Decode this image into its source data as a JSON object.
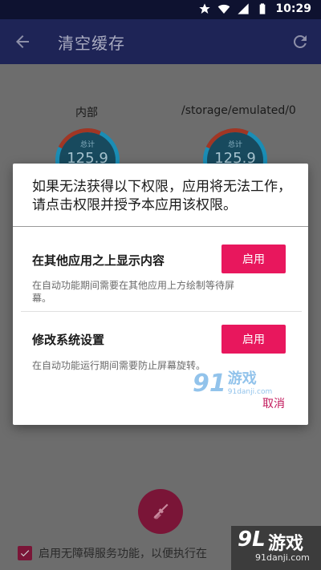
{
  "status_bar": {
    "time": "10:29",
    "icons": [
      "star-icon",
      "wifi-icon",
      "cellular-signal-icon",
      "battery-icon"
    ]
  },
  "app_bar": {
    "title": "清空缓存",
    "back_icon": "arrow-back-icon",
    "refresh_icon": "refresh-icon"
  },
  "storage": [
    {
      "label": "内部",
      "gauge_label": "总计",
      "gauge_value": "125.9"
    },
    {
      "label": "/storage/emulated/0",
      "gauge_label": "总计",
      "gauge_value": "125.9"
    }
  ],
  "dialog": {
    "header": "如果无法获得以下权限，应用将无法工作，请点击权限并授予本应用该权限。",
    "permissions": [
      {
        "title": "在其他应用之上显示内容",
        "button": "启用",
        "description": "在自动功能期间需要在其他应用上方绘制等待屏幕。"
      },
      {
        "title": "修改系统设置",
        "button": "启用",
        "description": "在自动功能运行期间需要防止屏幕旋转。"
      }
    ],
    "cancel": "取消"
  },
  "fab": {
    "icon": "broom-icon"
  },
  "bottom": {
    "checkbox_checked": true,
    "text": "启用无障碍服务功能，以便执行在"
  },
  "watermarks": {
    "center": {
      "logo": "91",
      "name": "游戏",
      "url": "91danji.com"
    },
    "corner": {
      "logo": "9L",
      "name": "游戏",
      "url": "91danji.com"
    }
  },
  "colors": {
    "accent": "#e8175d",
    "app_bar": "#1e2456",
    "gauge_ring": "#1a8db5"
  }
}
